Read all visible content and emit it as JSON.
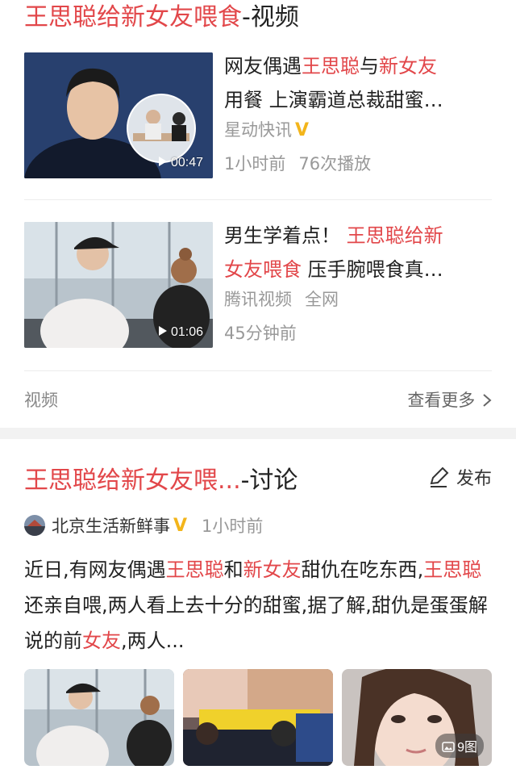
{
  "video_section": {
    "title_highlight": "王思聪给新女友喂食",
    "title_suffix": "-视频",
    "items": [
      {
        "title_parts": [
          "网友偶遇",
          "王思聪",
          "与",
          "新女友"
        ],
        "title_line2": "用餐 上演霸道总裁甜蜜…",
        "source": "星动快讯",
        "verified_badge": "V",
        "time": "1小时前",
        "plays": "76次播放",
        "duration": "00:47"
      },
      {
        "title_parts": [
          "男生学着点！ ",
          "王思聪给新"
        ],
        "title_line2_highlight": "女友喂食",
        "title_line2_rest": " 压手腕喂食真…",
        "source": "腾讯视频",
        "scope": "全网",
        "time": "45分钟前",
        "duration": "01:06"
      }
    ],
    "footer_label": "视频",
    "more_label": "查看更多"
  },
  "discussion_section": {
    "title_highlight": "王思聪给新女友喂...",
    "title_suffix": "-讨论",
    "publish_label": "发布",
    "author": "北京生活新鲜事",
    "verified_badge": "V",
    "time": "1小时前",
    "post": {
      "seg1": "近日,有网友偶遇",
      "hl1": "王思聪",
      "seg2": "和",
      "hl2": "新女友",
      "seg3": "甜仇在吃东西,",
      "hl3": "王思聪",
      "seg4": "还亲自喂,两人看上去十分的甜蜜,据了解,甜仇是蛋蛋解说的前",
      "hl4": "女友",
      "seg5": ",两人..."
    },
    "image_count": "9图"
  },
  "colors": {
    "highlight": "#e2474a",
    "muted": "#999999",
    "verified": "#f3b51b",
    "section_gap": "#f2f2f2"
  }
}
